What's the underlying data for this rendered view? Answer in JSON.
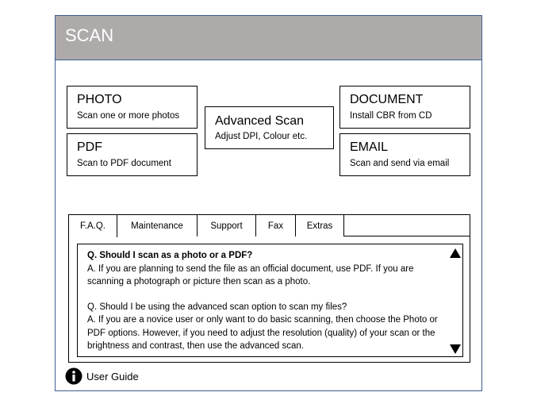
{
  "window": {
    "title": "SCAN"
  },
  "cards": {
    "photo": {
      "title": "PHOTO",
      "subtitle": "Scan one or more photos"
    },
    "pdf": {
      "title": "PDF",
      "subtitle": "Scan to PDF document"
    },
    "advanced": {
      "title": "Advanced Scan",
      "subtitle": "Adjust DPI, Colour etc."
    },
    "document": {
      "title": "DOCUMENT",
      "subtitle": "Install CBR from CD"
    },
    "email": {
      "title": "EMAIL",
      "subtitle": "Scan and send via email"
    }
  },
  "tabs": [
    {
      "label": "F.A.Q."
    },
    {
      "label": "Maintenance"
    },
    {
      "label": "Support"
    },
    {
      "label": "Fax"
    },
    {
      "label": "Extras"
    }
  ],
  "faq": {
    "q1": "Q. Should I scan as a photo or a PDF?",
    "a1": "A. If you are planning to send the file as an official document, use PDF. If you are scanning a photograph or picture then scan as a photo.",
    "q2": "Q. Should I be using the advanced scan option to scan my files?",
    "a2": "A. If you are a novice user or only want to do basic scanning, then choose the Photo or PDF options. However, if you need to adjust the resolution (quality) of your scan or the brightness and contrast, then use the advanced scan."
  },
  "footer": {
    "guide_label": "User Guide",
    "guide_icon": "info-icon"
  },
  "colors": {
    "titlebar": "#aeaaaa",
    "frame_border": "#3f5d8f"
  }
}
